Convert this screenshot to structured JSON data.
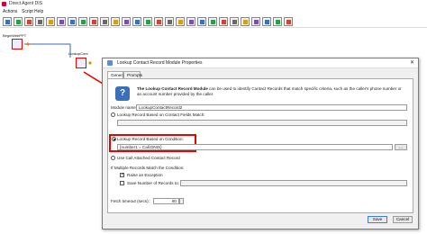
{
  "window": {
    "title": "Direct Agent DIS"
  },
  "menu": [
    "Actions",
    "Script",
    "Help"
  ],
  "toolbar": {
    "buttons": [
      "home-icon",
      "save-icon",
      "undo-icon",
      "cut-icon",
      "copy-icon",
      "paste-icon",
      "delete-icon",
      "properties-icon",
      "run-icon",
      "stop-icon",
      "module-icon",
      "module-icon",
      "module-icon",
      "module-icon",
      "module-icon",
      "module-icon",
      "module-icon",
      "module-icon",
      "module-icon",
      "module-icon",
      "module-icon",
      "module-icon",
      "module-icon",
      "module-icon",
      "module-icon",
      "module-icon",
      "module-icon"
    ]
  },
  "canvas": {
    "node1_label": "BeginWebPPT",
    "node2_label": "LookupCont"
  },
  "dialog": {
    "title": "Lookup Contact Record Module Properties",
    "close_glyph": "✕",
    "tabs": [
      "General",
      "Prompts"
    ],
    "description_bold": "The Lookup Contact Record Module",
    "description_rest": " can be used to identify Contact Records that match specific criteria, such as the caller's phone number or an account number provided by the caller.",
    "module_name_label": "Module name:",
    "module_name_value": "LookupContactRecord2",
    "opt_fields_label": "Lookup Record Based on Contact Fields Match:",
    "opt_condition_label": "Lookup Record Based on Condition:",
    "condition_value": "{number1 = Call.DNIS}",
    "ellipsis": "...",
    "opt_attached_label": "Use Call Attached Contact Record",
    "multiple_label": "If Multiple Records Match the Condition:",
    "raise_label": "Raise an Exception",
    "save_number_label": "Save Number of Records to:",
    "fetch_label": "Fetch timeout (secs):",
    "fetch_value": "60",
    "save_button": "Save",
    "cancel_button": "Cancel"
  }
}
